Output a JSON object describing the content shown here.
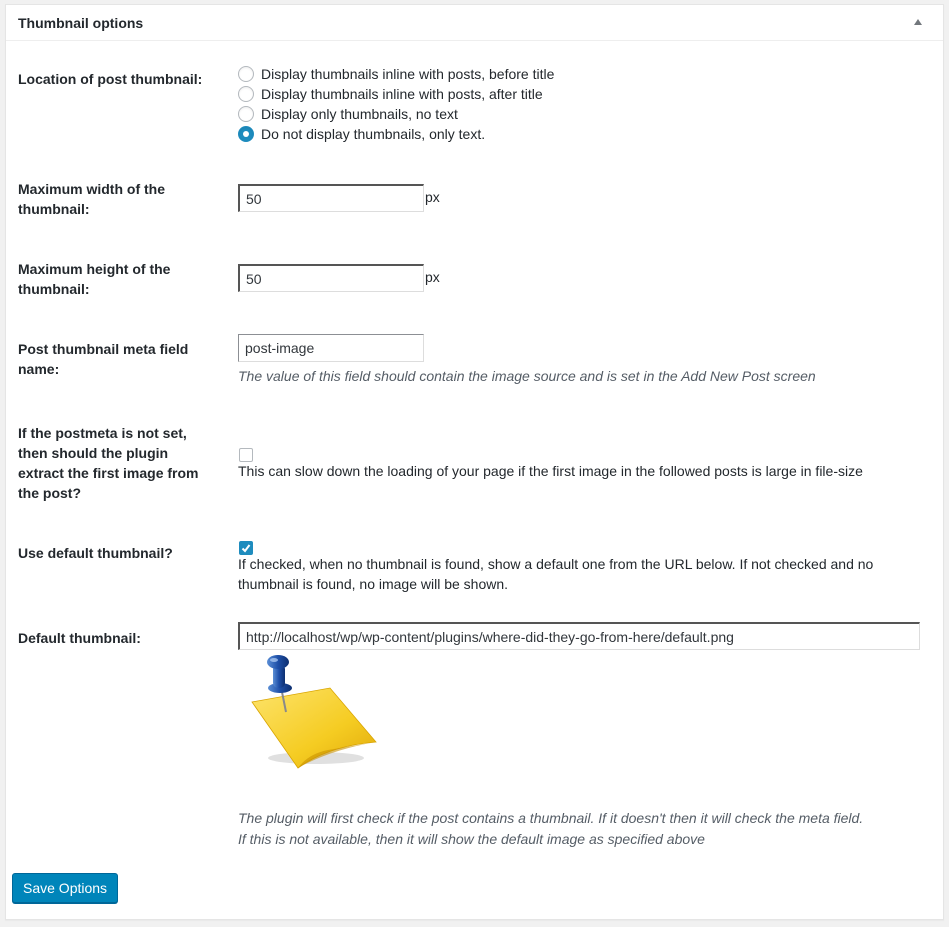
{
  "panel": {
    "title": "Thumbnail options",
    "toggle_icon": "triangle-up-icon"
  },
  "location": {
    "label": "Location of post thumbnail:",
    "options": [
      {
        "label": "Display thumbnails inline with posts, before title",
        "checked": false
      },
      {
        "label": "Display thumbnails inline with posts, after title",
        "checked": false
      },
      {
        "label": "Display only thumbnails, no text",
        "checked": false
      },
      {
        "label": "Do not display thumbnails, only text.",
        "checked": true
      }
    ]
  },
  "max_width": {
    "label_line1": "Maximum width of the",
    "label_line2": "thumbnail:",
    "value": "50",
    "unit": "px"
  },
  "max_height": {
    "label_line1": "Maximum height of the",
    "label_line2": "thumbnail:",
    "value": "50",
    "unit": "px"
  },
  "meta_field": {
    "label_line1": "Post thumbnail meta field",
    "label_line2": "name:",
    "value": "post-image",
    "description": "The value of this field should contain the image source and is set in the Add New Post screen"
  },
  "extract_first": {
    "label_line1": "If the postmeta is not set,",
    "label_line2": "then should the plugin",
    "label_line3": "extract the first image from",
    "label_line4": "the post?",
    "checked": false,
    "help": "This can slow down the loading of your page if the first image in the followed posts is large in file-size"
  },
  "use_default": {
    "label": "Use default thumbnail?",
    "checked": true,
    "help_line1": "If checked, when no thumbnail is found, show a default one from the URL below. If not checked and no",
    "help_line2": "thumbnail is found, no image will be shown."
  },
  "default_thumb": {
    "label": "Default thumbnail:",
    "value": "http://localhost/wp/wp-content/plugins/where-did-they-go-from-here/default.png",
    "image": "pushpin-sticky-note-image",
    "note_line1": "The plugin will first check if the post contains a thumbnail. If it doesn't then it will check the meta field.",
    "note_line2": "If this is not available, then it will show the default image as specified above"
  },
  "save_label": "Save Options",
  "colors": {
    "accent": "#1e8cbe",
    "button": "#0085ba",
    "note_yellow": "#f5cc22"
  }
}
